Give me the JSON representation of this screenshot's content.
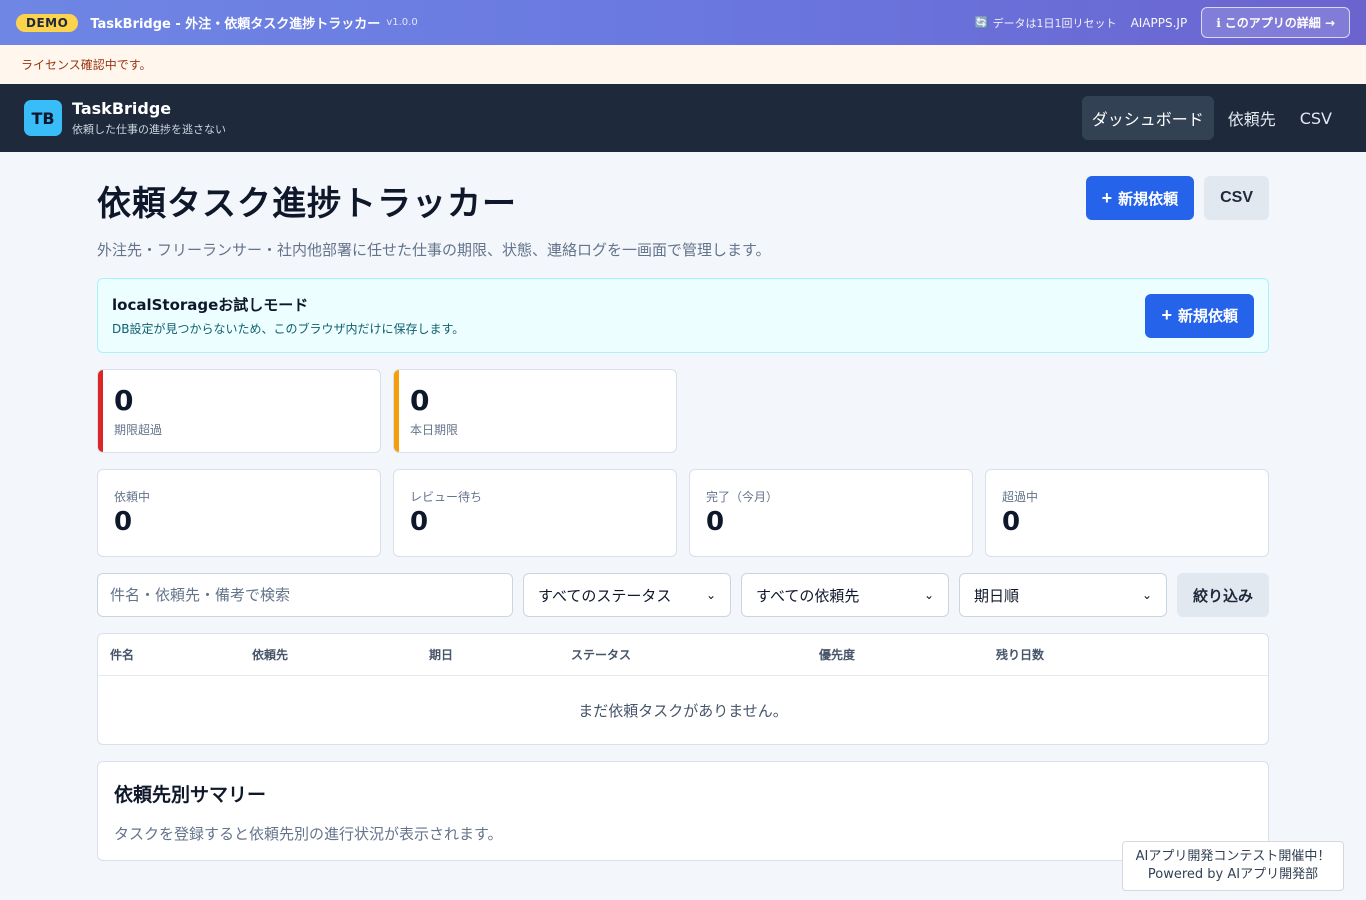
{
  "demo": {
    "badge": "DEMO",
    "title": "TaskBridge - 外注・依頼タスク進捗トラッカー",
    "version": "v1.0.0",
    "reset_icon": "refresh-icon",
    "reset_text": "データは1日1回リセット",
    "site": "AIAPPS.JP",
    "detail_button": "このアプリの詳細 →",
    "detail_icon": "info-icon"
  },
  "license": {
    "message": "ライセンス確認中です。"
  },
  "header": {
    "logo": "TB",
    "app_name": "TaskBridge",
    "tagline": "依頼した仕事の進捗を逃さない",
    "nav": [
      {
        "label": "ダッシュボード",
        "active": true
      },
      {
        "label": "依頼先",
        "active": false
      },
      {
        "label": "CSV",
        "active": false
      }
    ]
  },
  "page": {
    "title": "依頼タスク進捗トラッカー",
    "subtitle": "外注先・フリーランサー・社内他部署に任せた仕事の期限、状態、連絡ログを一画面で管理します。",
    "new_button": "新規依頼",
    "csv_button": "CSV"
  },
  "notice": {
    "title": "localStorageお試しモード",
    "text": "DB設定が見つからないため、このブラウザ内だけに保存します。",
    "button": "新規依頼"
  },
  "alerts": [
    {
      "value": "0",
      "label": "期限超過",
      "color": "#dc2626"
    },
    {
      "value": "0",
      "label": "本日期限",
      "color": "#f59e0b"
    }
  ],
  "stats": [
    {
      "label": "依頼中",
      "value": "0"
    },
    {
      "label": "レビュー待ち",
      "value": "0"
    },
    {
      "label": "完了（今月）",
      "value": "0"
    },
    {
      "label": "超過中",
      "value": "0"
    }
  ],
  "filters": {
    "search_placeholder": "件名・依頼先・備考で検索",
    "status": "すべてのステータス",
    "assignee": "すべての依頼先",
    "sort": "期日順",
    "button": "絞り込み"
  },
  "table": {
    "columns": [
      "件名",
      "依頼先",
      "期日",
      "ステータス",
      "優先度",
      "残り日数"
    ],
    "empty": "まだ依頼タスクがありません。"
  },
  "summary": {
    "title": "依頼先別サマリー",
    "text": "タスクを登録すると依頼先別の進行状況が表示されます。"
  },
  "contest": {
    "line1": "AIアプリ開発コンテスト開催中！",
    "line2": "Powered by AIアプリ開発部"
  }
}
